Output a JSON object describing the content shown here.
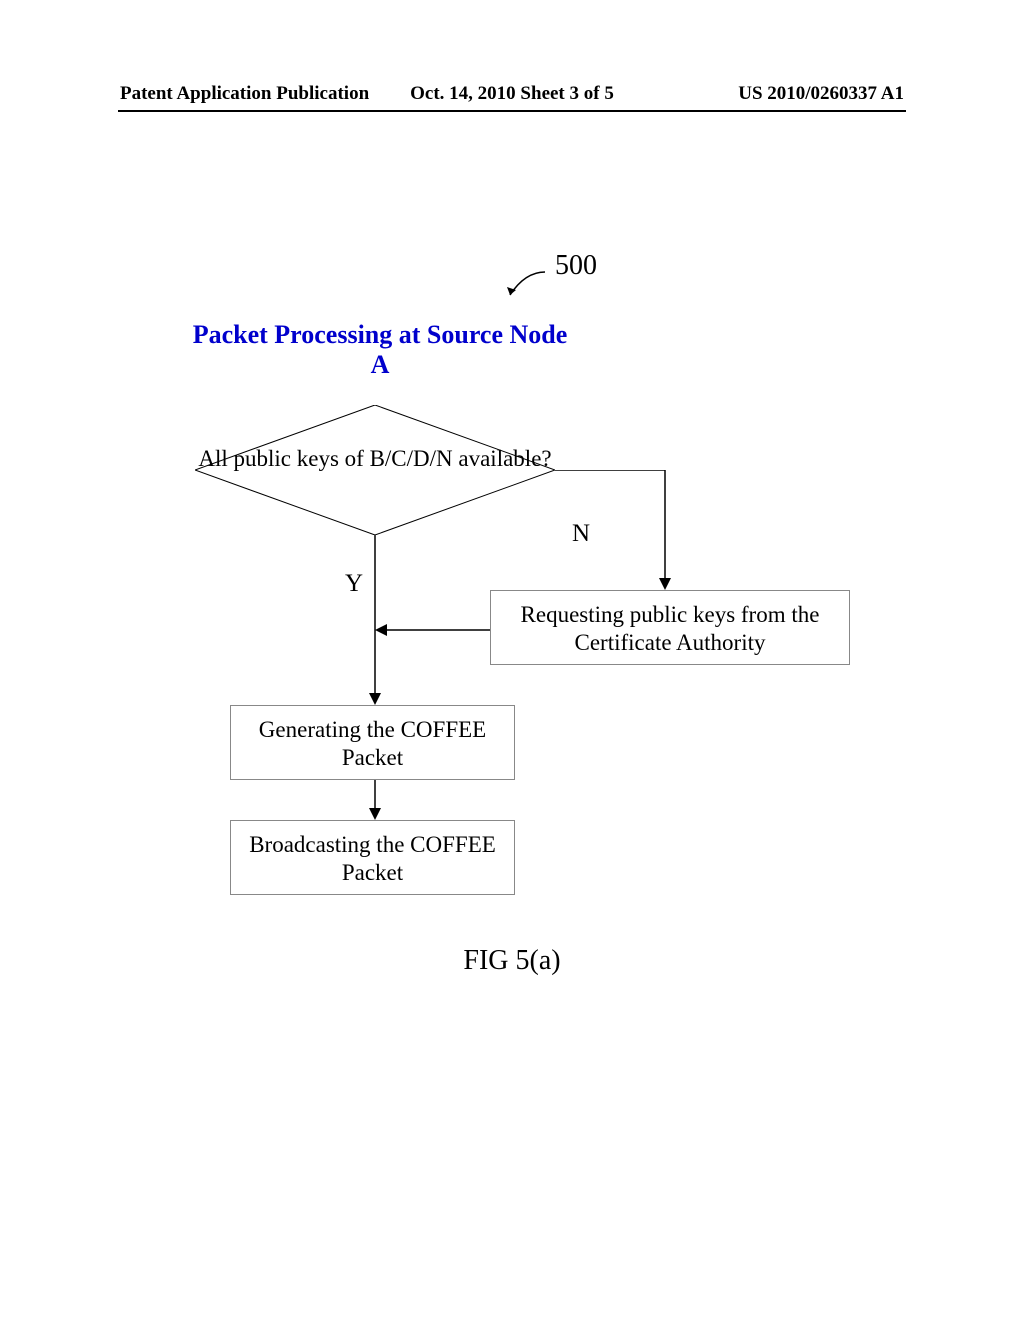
{
  "header": {
    "left": "Patent Application Publication",
    "center": "Oct. 14, 2010  Sheet 3 of 5",
    "right": "US 2010/0260337 A1"
  },
  "diagram": {
    "ref_number": "500",
    "title": "Packet Processing at Source Node A",
    "decision": "All public keys of B/C/D/N available?",
    "label_yes": "Y",
    "label_no": "N",
    "box_request": "Requesting public keys from the Certificate Authority",
    "box_generate": "Generating the COFFEE Packet",
    "box_broadcast": "Broadcasting the COFFEE Packet",
    "figure_caption": "FIG 5(a)"
  },
  "chart_data": {
    "type": "flowchart",
    "title": "Packet Processing at Source Node A",
    "reference_number": "500",
    "nodes": [
      {
        "id": "decision",
        "type": "decision",
        "text": "All public keys of B/C/D/N available?"
      },
      {
        "id": "request",
        "type": "process",
        "text": "Requesting public keys from the Certificate Authority"
      },
      {
        "id": "generate",
        "type": "process",
        "text": "Generating the COFFEE Packet"
      },
      {
        "id": "broadcast",
        "type": "process",
        "text": "Broadcasting the COFFEE Packet"
      }
    ],
    "edges": [
      {
        "from": "decision",
        "to": "request",
        "label": "N"
      },
      {
        "from": "decision",
        "to": "generate",
        "label": "Y"
      },
      {
        "from": "request",
        "to": "generate",
        "label": ""
      },
      {
        "from": "generate",
        "to": "broadcast",
        "label": ""
      }
    ],
    "figure_label": "FIG 5(a)"
  }
}
